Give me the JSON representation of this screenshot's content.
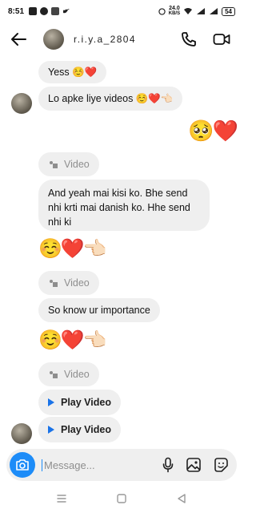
{
  "status_bar": {
    "time": "8:51",
    "net_speed_value": "24.0",
    "net_speed_unit": "KB/S",
    "battery": "54"
  },
  "header": {
    "username": "r.i.y.a_2804"
  },
  "messages": [
    {
      "kind": "received",
      "text": "Yess ☺️❤️"
    },
    {
      "kind": "received",
      "text": "Lo apke liye videos ☺️❤️👈🏻"
    },
    {
      "kind": "sent",
      "text": "🥺❤️"
    },
    {
      "kind": "received",
      "text": "Video"
    },
    {
      "kind": "received",
      "text": "And yeah mai kisi ko. Bhe send nhi krti mai danish ko. Hhe send nhi ki"
    },
    {
      "kind": "received",
      "text": "☺️❤️👈🏻"
    },
    {
      "kind": "received",
      "text": "Video"
    },
    {
      "kind": "received",
      "text": "So know ur importance"
    },
    {
      "kind": "received",
      "text": "☺️❤️👈🏻"
    },
    {
      "kind": "received",
      "text": "Video"
    },
    {
      "kind": "received",
      "text": "Play Video"
    },
    {
      "kind": "received",
      "text": "Play Video"
    }
  ],
  "composer": {
    "placeholder": "Message..."
  },
  "icons": {
    "back": "arrow-left-icon",
    "call": "phone-icon",
    "video_call": "video-camera-icon",
    "camera": "camera-icon",
    "mic": "microphone-icon",
    "gallery": "image-icon",
    "sticker": "sticker-icon"
  },
  "colors": {
    "accent": "#1d8cf8",
    "bubble": "#efefef",
    "muted_text": "#8e8e8e"
  }
}
